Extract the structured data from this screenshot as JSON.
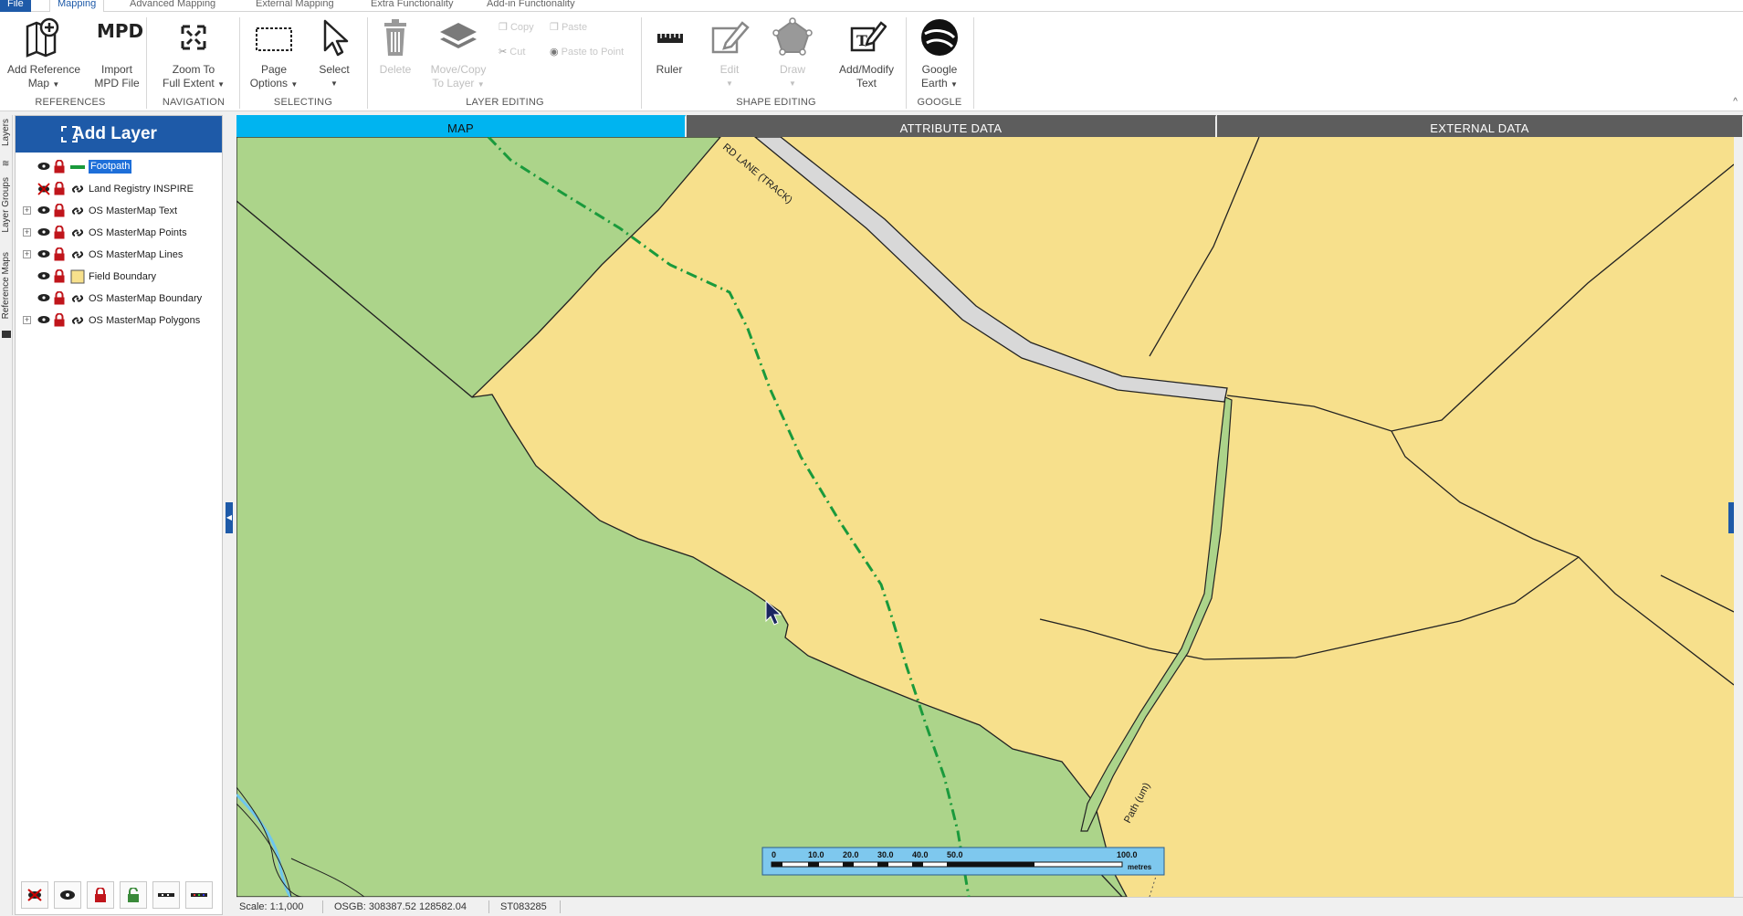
{
  "menu": {
    "tabs": [
      "File",
      "Mapping",
      "Advanced Mapping",
      "External Mapping",
      "Extra Functionality",
      "Add-in Functionality"
    ]
  },
  "ribbon": {
    "add_reference_map": [
      "Add Reference",
      "Map"
    ],
    "import_mpd": [
      "Import",
      "MPD File"
    ],
    "mpd_badge": "MPD",
    "zoom_full_extent": [
      "Zoom To",
      "Full Extent"
    ],
    "page_options": [
      "Page",
      "Options"
    ],
    "select": "Select",
    "delete": "Delete",
    "move_copy": [
      "Move/Copy",
      "To Layer"
    ],
    "copy": "Copy",
    "paste": "Paste",
    "cut": "Cut",
    "paste_to_point": "Paste to Point",
    "ruler": "Ruler",
    "edit": "Edit",
    "draw": "Draw",
    "add_modify_text": [
      "Add/Modify",
      "Text"
    ],
    "google_earth": [
      "Google",
      "Earth"
    ],
    "groups": {
      "references": "REFERENCES",
      "navigation": "NAVIGATION",
      "selecting": "SELECTING",
      "layer_editing": "LAYER EDITING",
      "shape_editing": "SHAPE EDITING",
      "google": "GOOGLE"
    }
  },
  "left_rail": {
    "tabs": [
      "Layers",
      "Layer Groups",
      "Reference Maps"
    ]
  },
  "layers_panel": {
    "add_layer": "Add Layer",
    "layers": [
      {
        "name": "Footpath",
        "expandable": false,
        "selected": true,
        "symbol": "green-line",
        "visibility": "visible"
      },
      {
        "name": "Land Registry INSPIRE",
        "expandable": false,
        "selected": false,
        "symbol": "link",
        "visibility": "hidden"
      },
      {
        "name": "OS MasterMap Text",
        "expandable": true,
        "selected": false,
        "symbol": "link",
        "visibility": "visible"
      },
      {
        "name": "OS MasterMap Points",
        "expandable": true,
        "selected": false,
        "symbol": "link",
        "visibility": "visible"
      },
      {
        "name": "OS MasterMap Lines",
        "expandable": true,
        "selected": false,
        "symbol": "link",
        "visibility": "visible"
      },
      {
        "name": "Field Boundary",
        "expandable": false,
        "selected": false,
        "symbol": "yellow-fill",
        "visibility": "visible"
      },
      {
        "name": "OS MasterMap Boundary",
        "expandable": false,
        "selected": false,
        "symbol": "link",
        "visibility": "visible"
      },
      {
        "name": "OS MasterMap Polygons",
        "expandable": true,
        "selected": false,
        "symbol": "link",
        "visibility": "visible"
      }
    ]
  },
  "view_tabs": {
    "map": "MAP",
    "attribute": "ATTRIBUTE DATA",
    "external": "EXTERNAL DATA"
  },
  "map": {
    "road_label": "RD LANE (TRACK)",
    "path_label": "Path (um)",
    "scale_bar": {
      "ticks": [
        "0",
        "10.0",
        "20.0",
        "30.0",
        "40.0",
        "50.0",
        "100.0"
      ],
      "unit": "metres"
    },
    "colors": {
      "field": "#f7e08c",
      "grass": "#acd48a",
      "track": "#d8d8d8",
      "footpath": "#1a9a3c",
      "water": "#6ec6ee"
    }
  },
  "status": {
    "scale": "Scale: 1:1,000",
    "coords": "OSGB: 308387.52  128582.04",
    "grid_ref": "ST083285"
  }
}
